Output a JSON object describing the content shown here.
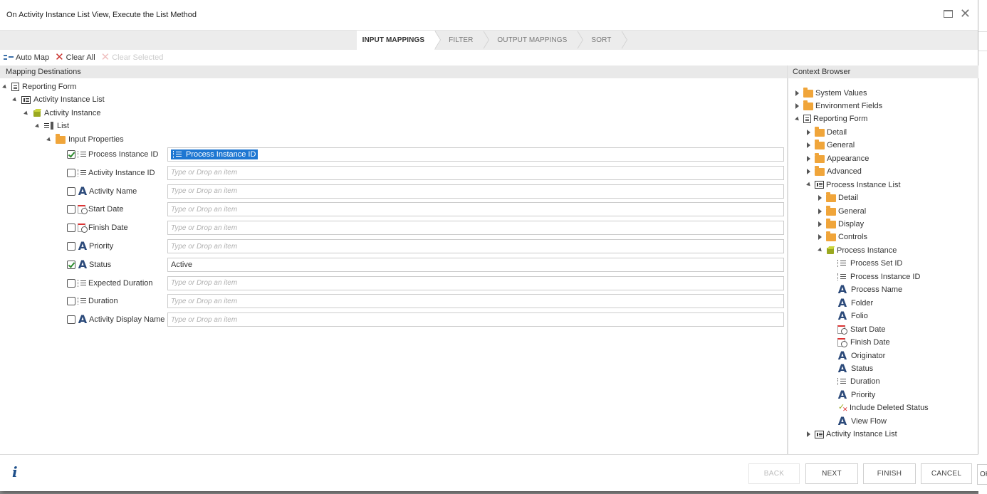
{
  "dialog": {
    "title": "On Activity Instance List View, Execute the List Method"
  },
  "wizard": {
    "steps": [
      "INPUT MAPPINGS",
      "FILTER",
      "OUTPUT MAPPINGS",
      "SORT"
    ],
    "active": "INPUT MAPPINGS"
  },
  "toolbar": {
    "auto_map": "Auto Map",
    "clear_all": "Clear All",
    "clear_selected": "Clear Selected"
  },
  "mapping": {
    "header": "Mapping Destinations",
    "tree": {
      "reporting_form": "Reporting Form",
      "activity_instance_list": "Activity Instance List",
      "activity_instance": "Activity Instance",
      "list": "List",
      "input_properties": "Input Properties"
    },
    "placeholder": "Type or Drop an item",
    "properties": [
      {
        "label": "Process Instance ID",
        "icon": "number-icon",
        "checked": true,
        "value": "Process Instance ID",
        "chip": true
      },
      {
        "label": "Activity Instance ID",
        "icon": "number-icon",
        "checked": false,
        "value": ""
      },
      {
        "label": "Activity Name",
        "icon": "text-icon",
        "checked": false,
        "value": ""
      },
      {
        "label": "Start Date",
        "icon": "date-icon",
        "checked": false,
        "value": ""
      },
      {
        "label": "Finish Date",
        "icon": "date-icon",
        "checked": false,
        "value": ""
      },
      {
        "label": "Priority",
        "icon": "text-icon",
        "checked": false,
        "value": ""
      },
      {
        "label": "Status",
        "icon": "text-icon",
        "checked": true,
        "value": "Active"
      },
      {
        "label": "Expected Duration",
        "icon": "number-icon",
        "checked": false,
        "value": ""
      },
      {
        "label": "Duration",
        "icon": "number-icon",
        "checked": false,
        "value": ""
      },
      {
        "label": "Activity Display Name",
        "icon": "text-icon",
        "checked": false,
        "value": ""
      }
    ]
  },
  "context": {
    "header": "Context Browser",
    "items": [
      {
        "label": "System Values",
        "icon": "folder-icon",
        "level": 0,
        "state": "collapsed"
      },
      {
        "label": "Environment Fields",
        "icon": "folder-icon",
        "level": 0,
        "state": "collapsed"
      },
      {
        "label": "Reporting Form",
        "icon": "form-icon",
        "level": 0,
        "state": "expanded"
      },
      {
        "label": "Detail",
        "icon": "folder-icon",
        "level": 1,
        "state": "collapsed"
      },
      {
        "label": "General",
        "icon": "folder-icon",
        "level": 1,
        "state": "collapsed"
      },
      {
        "label": "Appearance",
        "icon": "folder-icon",
        "level": 1,
        "state": "collapsed"
      },
      {
        "label": "Advanced",
        "icon": "folder-icon",
        "level": 1,
        "state": "collapsed"
      },
      {
        "label": "Process Instance List",
        "icon": "list-icon",
        "level": 1,
        "state": "expanded"
      },
      {
        "label": "Detail",
        "icon": "folder-icon",
        "level": 2,
        "state": "collapsed"
      },
      {
        "label": "General",
        "icon": "folder-icon",
        "level": 2,
        "state": "collapsed"
      },
      {
        "label": "Display",
        "icon": "folder-icon",
        "level": 2,
        "state": "collapsed"
      },
      {
        "label": "Controls",
        "icon": "folder-icon",
        "level": 2,
        "state": "collapsed"
      },
      {
        "label": "Process Instance",
        "icon": "cube-icon",
        "level": 2,
        "state": "expanded"
      },
      {
        "label": "Process Set ID",
        "icon": "number-icon",
        "level": 3,
        "state": "leaf"
      },
      {
        "label": "Process Instance ID",
        "icon": "number-icon",
        "level": 3,
        "state": "leaf"
      },
      {
        "label": "Process Name",
        "icon": "text-icon",
        "level": 3,
        "state": "leaf"
      },
      {
        "label": "Folder",
        "icon": "text-icon",
        "level": 3,
        "state": "leaf"
      },
      {
        "label": "Folio",
        "icon": "text-icon",
        "level": 3,
        "state": "leaf"
      },
      {
        "label": "Start Date",
        "icon": "date-icon",
        "level": 3,
        "state": "leaf"
      },
      {
        "label": "Finish Date",
        "icon": "date-icon",
        "level": 3,
        "state": "leaf"
      },
      {
        "label": "Originator",
        "icon": "text-icon",
        "level": 3,
        "state": "leaf"
      },
      {
        "label": "Status",
        "icon": "text-icon",
        "level": 3,
        "state": "leaf"
      },
      {
        "label": "Duration",
        "icon": "number-icon",
        "level": 3,
        "state": "leaf"
      },
      {
        "label": "Priority",
        "icon": "text-icon",
        "level": 3,
        "state": "leaf"
      },
      {
        "label": "Include Deleted Status",
        "icon": "boolean-icon",
        "level": 3,
        "state": "leaf"
      },
      {
        "label": "View Flow",
        "icon": "text-icon",
        "level": 3,
        "state": "leaf"
      },
      {
        "label": "Activity Instance List",
        "icon": "list-icon",
        "level": 1,
        "state": "collapsed"
      }
    ]
  },
  "footer": {
    "back": "BACK",
    "next": "NEXT",
    "finish": "FINISH",
    "cancel": "CANCEL",
    "ok_fragment": "OK"
  }
}
